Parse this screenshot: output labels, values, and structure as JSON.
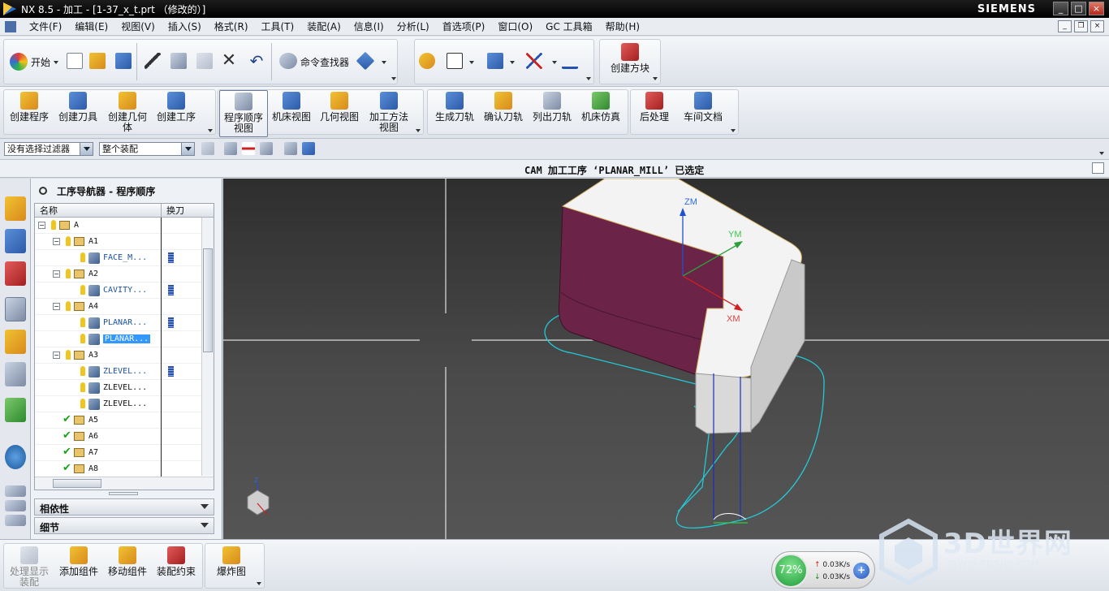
{
  "window": {
    "title": "NX 8.5 - 加工 - [1-37_x_t.prt （修改的）]",
    "brand": "SIEMENS",
    "controls": [
      "_",
      "□",
      "×"
    ]
  },
  "menu": [
    "文件(F)",
    "编辑(E)",
    "视图(V)",
    "插入(S)",
    "格式(R)",
    "工具(T)",
    "装配(A)",
    "信息(I)",
    "分析(L)",
    "首选项(P)",
    "窗口(O)",
    "GC 工具箱",
    "帮助(H)"
  ],
  "toolbar1": {
    "start": "开始",
    "command_finder": "命令查找器",
    "create_block": "创建方块"
  },
  "toolbar2": {
    "items": [
      "创建程序",
      "创建刀具",
      "创建几何体",
      "创建工序",
      "程序顺序视图",
      "机床视图",
      "几何视图",
      "加工方法视图",
      "生成刀轨",
      "确认刀轨",
      "列出刀轨",
      "机床仿真",
      "后处理",
      "车间文档"
    ]
  },
  "selection": {
    "filter": "没有选择过滤器",
    "scope": "整个装配"
  },
  "status": {
    "message": "CAM 加工工序 ‘PLANAR_MILL’ 已选定"
  },
  "navigator": {
    "title": "工序导航器 - 程序顺序",
    "columns": [
      "名称",
      "换刀"
    ],
    "rows": [
      {
        "name": "A",
        "kind": "folder",
        "indent": 0,
        "state": "bulb",
        "toggle": "−"
      },
      {
        "name": "A1",
        "kind": "folder",
        "indent": 1,
        "state": "bulb",
        "toggle": "−"
      },
      {
        "name": "FACE_M...",
        "kind": "op",
        "indent": 2,
        "state": "bulb",
        "tool": true
      },
      {
        "name": "A2",
        "kind": "folder",
        "indent": 1,
        "state": "bulb",
        "toggle": "−"
      },
      {
        "name": "CAVITY...",
        "kind": "op",
        "indent": 2,
        "state": "bulb",
        "tool": true
      },
      {
        "name": "A4",
        "kind": "folder",
        "indent": 1,
        "state": "bulb",
        "toggle": "−"
      },
      {
        "name": "PLANAR...",
        "kind": "op",
        "indent": 2,
        "state": "bulb",
        "tool": true
      },
      {
        "name": "PLANAR...",
        "kind": "op",
        "indent": 2,
        "state": "bulb",
        "selected": true
      },
      {
        "name": "A3",
        "kind": "folder",
        "indent": 1,
        "state": "bulb",
        "toggle": "−"
      },
      {
        "name": "ZLEVEL...",
        "kind": "op",
        "indent": 2,
        "state": "bulb",
        "tool": true
      },
      {
        "name": "ZLEVEL...",
        "kind": "op",
        "indent": 2,
        "state": "bulb",
        "selected": false,
        "plain": true
      },
      {
        "name": "ZLEVEL...",
        "kind": "op",
        "indent": 2,
        "state": "bulb",
        "plain": true
      },
      {
        "name": "A5",
        "kind": "folder",
        "indent": 1,
        "state": "check"
      },
      {
        "name": "A6",
        "kind": "folder",
        "indent": 1,
        "state": "check"
      },
      {
        "name": "A7",
        "kind": "folder",
        "indent": 1,
        "state": "check"
      },
      {
        "name": "A8",
        "kind": "folder",
        "indent": 1,
        "state": "check"
      }
    ],
    "sections": [
      "相依性",
      "细节"
    ]
  },
  "viewport": {
    "axes": [
      "ZM",
      "YM",
      "XM"
    ],
    "triad": "Z"
  },
  "bottom_toolbar": {
    "items": [
      "处理显示装配",
      "添加组件",
      "移动组件",
      "装配约束",
      "爆炸图"
    ]
  },
  "network_widget": {
    "percent": "72%",
    "up": "0.03K/s",
    "down": "0.03K/s"
  },
  "watermark": {
    "title": "3D世界网",
    "url": "WWW.3DSJW.COM"
  }
}
